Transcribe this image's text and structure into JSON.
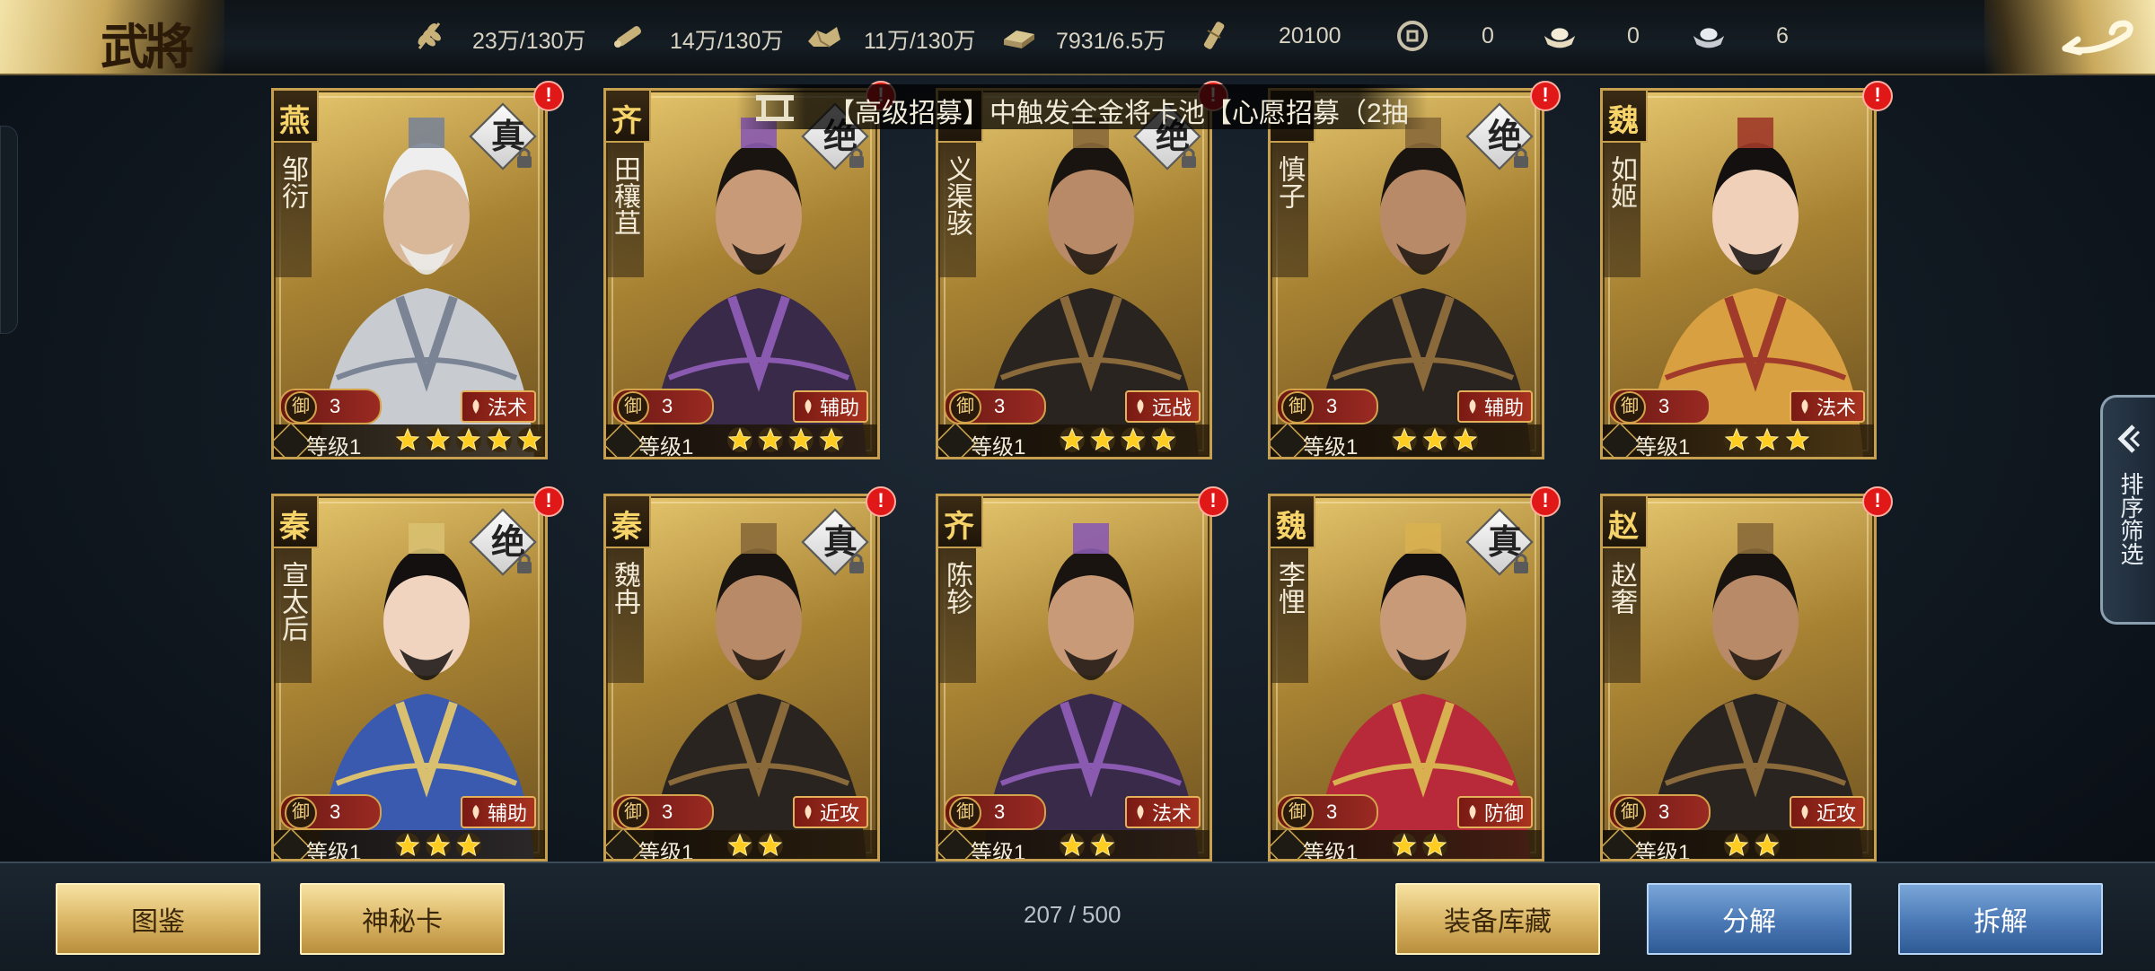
{
  "header": {
    "title": "武將",
    "resources": [
      {
        "icon": "grain-icon",
        "value": "23万/130万"
      },
      {
        "icon": "wood-icon",
        "value": "14万/130万"
      },
      {
        "icon": "stone-icon",
        "value": "11万/130万"
      },
      {
        "icon": "iron-icon",
        "value": "7931/6.5万"
      },
      {
        "icon": "decree-icon",
        "value": "20100"
      },
      {
        "icon": "coin-icon",
        "value": "0"
      },
      {
        "icon": "gold-ingot-icon",
        "value": "0"
      },
      {
        "icon": "silver-ingot-icon",
        "value": "6"
      }
    ]
  },
  "notice": {
    "text": "【高级招募】中触发全金将卡池【心愿招募（2抽"
  },
  "cards": [
    {
      "faction": "燕",
      "name": "邹衍",
      "quality": "真",
      "defense": "3",
      "role": "法术",
      "level": "等级1",
      "stars": 5,
      "palette": "silver"
    },
    {
      "faction": "齐",
      "name": "田穰苴",
      "quality": "绝",
      "defense": "3",
      "role": "辅助",
      "level": "等级1",
      "stars": 4,
      "palette": "purple"
    },
    {
      "faction": "",
      "name": "义渠骇",
      "quality": "绝",
      "defense": "3",
      "role": "远战",
      "level": "等级1",
      "stars": 4,
      "palette": "dark"
    },
    {
      "faction": "",
      "name": "慎子",
      "quality": "绝",
      "defense": "3",
      "role": "辅助",
      "level": "等级1",
      "stars": 3,
      "palette": "dark"
    },
    {
      "faction": "魏",
      "name": "如姬",
      "quality": "",
      "defense": "3",
      "role": "法术",
      "level": "等级1",
      "stars": 3,
      "palette": "gold"
    },
    {
      "faction": "秦",
      "name": "宣太后",
      "quality": "绝",
      "defense": "3",
      "role": "辅助",
      "level": "等级1",
      "stars": 3,
      "palette": "blue"
    },
    {
      "faction": "秦",
      "name": "魏冉",
      "quality": "真",
      "defense": "3",
      "role": "近攻",
      "level": "等级1",
      "stars": 2,
      "palette": "dark"
    },
    {
      "faction": "齐",
      "name": "陈轸",
      "quality": "",
      "defense": "3",
      "role": "法术",
      "level": "等级1",
      "stars": 2,
      "palette": "purple"
    },
    {
      "faction": "魏",
      "name": "李悝",
      "quality": "真",
      "defense": "3",
      "role": "防御",
      "level": "等级1",
      "stars": 2,
      "palette": "red"
    },
    {
      "faction": "赵",
      "name": "赵奢",
      "quality": "",
      "defense": "3",
      "role": "近攻",
      "level": "等级1",
      "stars": 2,
      "palette": "dark"
    }
  ],
  "defense_label": "御",
  "side_tab": {
    "label": "排序筛选"
  },
  "footer": {
    "atlas_label": "图鉴",
    "mystery_card_label": "神秘卡",
    "count": "207 / 500",
    "equipment_label": "装备库藏",
    "decompose_label": "分解",
    "dismantle_label": "拆解"
  },
  "colors": {
    "gold": "#c6a04e",
    "alert_red": "#e01818",
    "blue_button": "#4a78b4"
  }
}
